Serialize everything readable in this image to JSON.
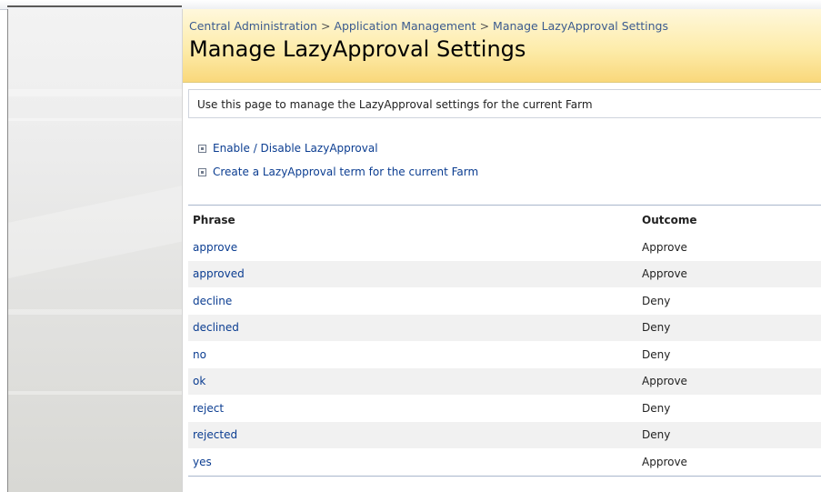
{
  "breadcrumb": {
    "items": [
      "Central Administration",
      "Application Management",
      "Manage LazyApproval Settings"
    ],
    "separator": ">"
  },
  "page": {
    "title": "Manage LazyApproval Settings",
    "description": "Use this page to manage the LazyApproval settings for the current Farm"
  },
  "links": [
    {
      "label": "Enable / Disable LazyApproval",
      "icon": "bullet-icon"
    },
    {
      "label": "Create a LazyApproval term for the current Farm",
      "icon": "bullet-icon"
    }
  ],
  "table": {
    "columns": [
      "Phrase",
      "Outcome"
    ],
    "rows": [
      {
        "phrase": "approve",
        "outcome": "Approve"
      },
      {
        "phrase": "approved",
        "outcome": "Approve"
      },
      {
        "phrase": "decline",
        "outcome": "Deny"
      },
      {
        "phrase": "declined",
        "outcome": "Deny"
      },
      {
        "phrase": "no",
        "outcome": "Deny"
      },
      {
        "phrase": "ok",
        "outcome": "Approve"
      },
      {
        "phrase": "reject",
        "outcome": "Deny"
      },
      {
        "phrase": "rejected",
        "outcome": "Deny"
      },
      {
        "phrase": "yes",
        "outcome": "Approve"
      }
    ]
  },
  "colors": {
    "link": "#0b3d91",
    "title_band_top": "#fff8dc",
    "title_band_bottom": "#f9d87b",
    "row_alt": "#f1f1f1"
  }
}
